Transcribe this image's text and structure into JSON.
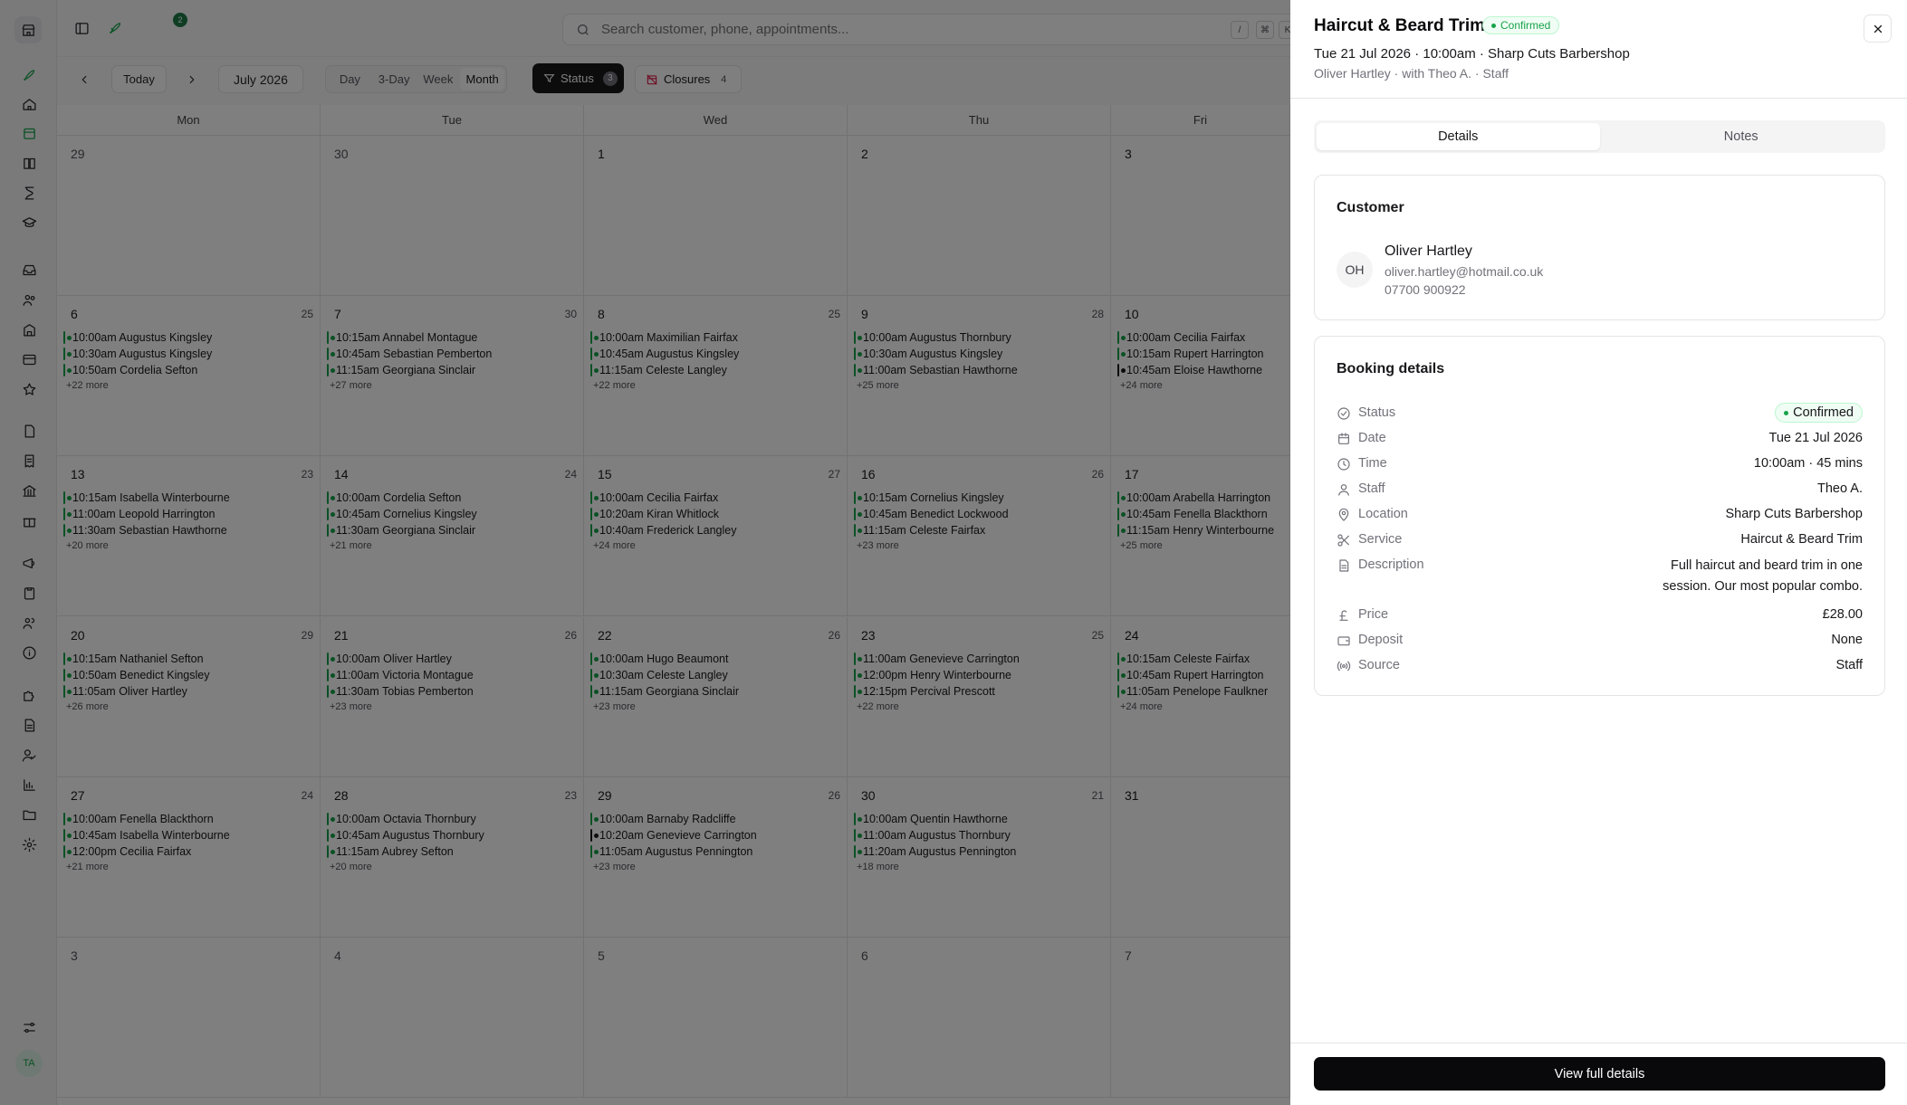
{
  "topbar": {
    "notif_count": "2",
    "search_placeholder": "Search customer, phone, appointments...",
    "kbd": [
      "/",
      "⌘",
      "K"
    ]
  },
  "toolbar": {
    "today": "Today",
    "month_label": "July 2026",
    "views": [
      "Day",
      "3-Day",
      "Week",
      "Month"
    ],
    "active_view": "Month",
    "status_label": "Status",
    "status_count": "3",
    "closures_label": "Closures",
    "closures_count": "4"
  },
  "calendar": {
    "weekdays": [
      "Mon",
      "Tue",
      "Wed",
      "Thu",
      "Fri"
    ],
    "weeks": [
      [
        {
          "day": "29",
          "muted": true,
          "count": "",
          "appts": [],
          "more": ""
        },
        {
          "day": "30",
          "muted": true,
          "count": "",
          "appts": [],
          "more": ""
        },
        {
          "day": "1",
          "count": "",
          "appts": [],
          "more": ""
        },
        {
          "day": "2",
          "count": "",
          "appts": [],
          "more": ""
        },
        {
          "day": "3",
          "count": "",
          "appts": [],
          "more": ""
        }
      ],
      [
        {
          "day": "6",
          "count": "25",
          "appts": [
            {
              "t": "10:00am Augustus Kingsley"
            },
            {
              "t": "10:30am Augustus Kingsley"
            },
            {
              "t": "10:50am Cordelia Sefton"
            }
          ],
          "more": "+22 more"
        },
        {
          "day": "7",
          "count": "30",
          "appts": [
            {
              "t": "10:15am Annabel Montague"
            },
            {
              "t": "10:45am Sebastian Pemberton"
            },
            {
              "t": "11:15am Georgiana Sinclair"
            }
          ],
          "more": "+27 more"
        },
        {
          "day": "8",
          "count": "25",
          "appts": [
            {
              "t": "10:00am Maximilian Fairfax"
            },
            {
              "t": "10:45am Augustus Kingsley"
            },
            {
              "t": "11:15am Celeste Langley"
            }
          ],
          "more": "+22 more"
        },
        {
          "day": "9",
          "count": "28",
          "appts": [
            {
              "t": "10:00am Augustus Thornbury"
            },
            {
              "t": "10:30am Augustus Kingsley"
            },
            {
              "t": "11:00am Sebastian Hawthorne"
            }
          ],
          "more": "+25 more"
        },
        {
          "day": "10",
          "count": "",
          "appts": [
            {
              "t": "10:00am Cecilia Fairfax"
            },
            {
              "t": "10:15am Rupert Harrington"
            },
            {
              "t": "10:45am Eloise Hawthorne",
              "dark": true
            }
          ],
          "more": "+24 more"
        }
      ],
      [
        {
          "day": "13",
          "count": "23",
          "appts": [
            {
              "t": "10:15am Isabella Winterbourne"
            },
            {
              "t": "11:00am Leopold Harrington"
            },
            {
              "t": "11:30am Sebastian Hawthorne"
            }
          ],
          "more": "+20 more"
        },
        {
          "day": "14",
          "count": "24",
          "appts": [
            {
              "t": "10:00am Cordelia Sefton"
            },
            {
              "t": "10:45am Cornelius Kingsley"
            },
            {
              "t": "11:30am Georgiana Sinclair"
            }
          ],
          "more": "+21 more"
        },
        {
          "day": "15",
          "count": "27",
          "appts": [
            {
              "t": "10:00am Cecilia Fairfax"
            },
            {
              "t": "10:20am Kiran Whitlock"
            },
            {
              "t": "10:40am Frederick Langley"
            }
          ],
          "more": "+24 more"
        },
        {
          "day": "16",
          "count": "26",
          "appts": [
            {
              "t": "10:15am Cornelius Kingsley"
            },
            {
              "t": "10:45am Benedict Lockwood"
            },
            {
              "t": "11:15am Celeste Fairfax"
            }
          ],
          "more": "+23 more"
        },
        {
          "day": "17",
          "count": "",
          "appts": [
            {
              "t": "10:00am Arabella Harrington"
            },
            {
              "t": "10:45am Fenella Blackthorn"
            },
            {
              "t": "11:15am Henry Winterbourne"
            }
          ],
          "more": "+25 more"
        }
      ],
      [
        {
          "day": "20",
          "count": "29",
          "appts": [
            {
              "t": "10:15am Nathaniel Sefton"
            },
            {
              "t": "10:50am Benedict Kingsley"
            },
            {
              "t": "11:05am Oliver Hartley"
            }
          ],
          "more": "+26 more"
        },
        {
          "day": "21",
          "count": "26",
          "appts": [
            {
              "t": "10:00am Oliver Hartley"
            },
            {
              "t": "11:00am Victoria Montague"
            },
            {
              "t": "11:30am Tobias Pemberton"
            }
          ],
          "more": "+23 more"
        },
        {
          "day": "22",
          "count": "26",
          "appts": [
            {
              "t": "10:00am Hugo Beaumont"
            },
            {
              "t": "10:30am Celeste Langley"
            },
            {
              "t": "11:15am Georgiana Sinclair"
            }
          ],
          "more": "+23 more"
        },
        {
          "day": "23",
          "count": "25",
          "appts": [
            {
              "t": "11:00am Genevieve Carrington"
            },
            {
              "t": "12:00pm Henry Winterbourne"
            },
            {
              "t": "12:15pm Percival Prescott"
            }
          ],
          "more": "+22 more"
        },
        {
          "day": "24",
          "count": "",
          "appts": [
            {
              "t": "10:15am Celeste Fairfax"
            },
            {
              "t": "10:45am Rupert Harrington"
            },
            {
              "t": "11:05am Penelope Faulkner"
            }
          ],
          "more": "+24 more"
        }
      ],
      [
        {
          "day": "27",
          "count": "24",
          "appts": [
            {
              "t": "10:00am Fenella Blackthorn"
            },
            {
              "t": "10:45am Isabella Winterbourne"
            },
            {
              "t": "12:00pm Cecilia Fairfax"
            }
          ],
          "more": "+21 more"
        },
        {
          "day": "28",
          "count": "23",
          "appts": [
            {
              "t": "10:00am Octavia Thornbury"
            },
            {
              "t": "10:45am Augustus Thornbury"
            },
            {
              "t": "11:15am Aubrey Sefton"
            }
          ],
          "more": "+20 more"
        },
        {
          "day": "29",
          "count": "26",
          "appts": [
            {
              "t": "10:00am Barnaby Radcliffe"
            },
            {
              "t": "10:20am Genevieve Carrington",
              "dark": true
            },
            {
              "t": "11:05am Augustus Pennington"
            }
          ],
          "more": "+23 more"
        },
        {
          "day": "30",
          "count": "21",
          "appts": [
            {
              "t": "10:00am Quentin Hawthorne"
            },
            {
              "t": "11:00am Augustus Thornbury"
            },
            {
              "t": "11:20am Augustus Pennington"
            }
          ],
          "more": "+18 more"
        },
        {
          "day": "31",
          "count": "",
          "appts": [],
          "more": ""
        }
      ],
      [
        {
          "day": "3",
          "muted": true,
          "count": "",
          "appts": [],
          "more": ""
        },
        {
          "day": "4",
          "muted": true,
          "count": "",
          "appts": [],
          "more": ""
        },
        {
          "day": "5",
          "muted": true,
          "count": "",
          "appts": [],
          "more": ""
        },
        {
          "day": "6",
          "muted": true,
          "count": "",
          "appts": [],
          "more": ""
        },
        {
          "day": "7",
          "muted": true,
          "count": "",
          "appts": [],
          "more": ""
        }
      ]
    ]
  },
  "panel": {
    "title": "Haircut & Beard Trim",
    "status_badge": "Confirmed",
    "when": "Tue 21 Jul 2026 · 10:00am · Sharp Cuts Barbershop",
    "who": "Oliver Hartley · with Theo A. · Staff",
    "tabs": [
      "Details",
      "Notes"
    ],
    "customer": {
      "heading": "Customer",
      "initials": "OH",
      "name": "Oliver Hartley",
      "email": "oliver.hartley@hotmail.co.uk",
      "phone": "07700 900922"
    },
    "booking": {
      "heading": "Booking details",
      "status_label": "Status",
      "status_value": "Confirmed",
      "date_label": "Date",
      "date_value": "Tue 21 Jul 2026",
      "time_label": "Time",
      "time_value": "10:00am · 45 mins",
      "staff_label": "Staff",
      "staff_value": "Theo A.",
      "location_label": "Location",
      "location_value": "Sharp Cuts Barbershop",
      "service_label": "Service",
      "service_value": "Haircut & Beard Trim",
      "description_label": "Description",
      "description_value": "Full haircut and beard trim in one session. Our most popular combo.",
      "price_label": "Price",
      "price_value": "£28.00",
      "deposit_label": "Deposit",
      "deposit_value": "None",
      "source_label": "Source",
      "source_value": "Staff"
    },
    "view_full": "View full details"
  },
  "rail": {
    "avatar": "TA",
    "icons": [
      "rocket-icon",
      "home-icon",
      "calendar-icon",
      "book-icon",
      "hourglass-icon",
      "graduation-cap-icon",
      "inbox-icon",
      "users-icon",
      "building-icon",
      "card-icon",
      "star-icon",
      "file-icon",
      "receipt-icon",
      "bank-icon",
      "gift-icon",
      "megaphone-icon",
      "clipboard-icon",
      "team-icon",
      "info-icon",
      "puzzle-icon",
      "document-icon",
      "user-check-icon",
      "chart-icon",
      "folder-icon",
      "settings-icon",
      "sliders-icon"
    ]
  },
  "colors": {
    "accent": "#16a34a",
    "dark": "#09090b"
  }
}
